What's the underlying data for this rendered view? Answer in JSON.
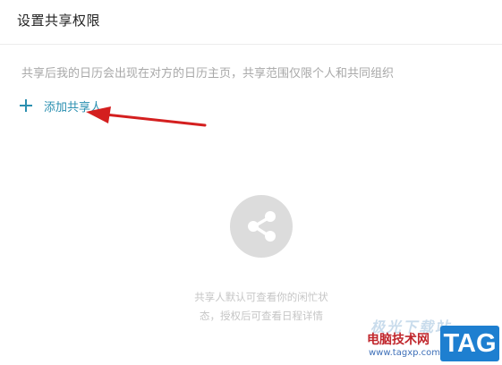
{
  "header": {
    "title": "设置共享权限"
  },
  "share": {
    "description": "共享后我的日历会出现在对方的日历主页，共享范围仅限个人和共同组织",
    "add_label": "添加共享人"
  },
  "empty_state": {
    "icon": "share-icon",
    "line1": "共享人默认可查看你的闲忙状",
    "line2": "态，授权后可查看日程详情"
  },
  "watermark": {
    "top_text": "极光下载站",
    "name": "电脑技术网",
    "url": "www.tagxp.com",
    "badge": "TAG"
  },
  "colors": {
    "accent": "#2a8fb0",
    "annotation": "#d41f1f",
    "placeholder_icon": "#dcdcdc"
  }
}
